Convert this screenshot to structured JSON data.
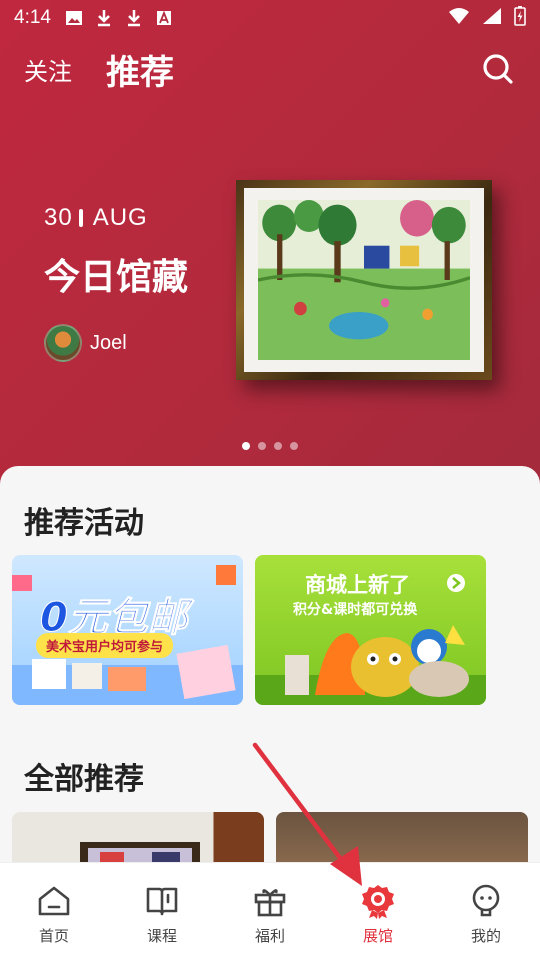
{
  "status_bar": {
    "time": "4:14"
  },
  "top_nav": {
    "follow_label": "关注",
    "recommend_label": "推荐"
  },
  "hero": {
    "date_day": "30",
    "date_month": "AUG",
    "title": "今日馆藏",
    "author": "Joel",
    "carousel_pages": 4,
    "carousel_active": 1
  },
  "sections": {
    "activities_title": "推荐活动",
    "all_title": "全部推荐"
  },
  "banners": [
    {
      "title": "0元包邮",
      "subtitle": "美术宝用户均可参与"
    },
    {
      "title": "商城上新了",
      "subtitle": "积分&课时都可兑换"
    }
  ],
  "tabs": [
    {
      "label": "首页",
      "icon": "home-icon"
    },
    {
      "label": "课程",
      "icon": "book-icon"
    },
    {
      "label": "福利",
      "icon": "gift-icon"
    },
    {
      "label": "展馆",
      "icon": "gallery-badge-icon"
    },
    {
      "label": "我的",
      "icon": "profile-icon"
    }
  ],
  "colors": {
    "brand": "#c0283f",
    "active_tab": "#e0323e"
  }
}
